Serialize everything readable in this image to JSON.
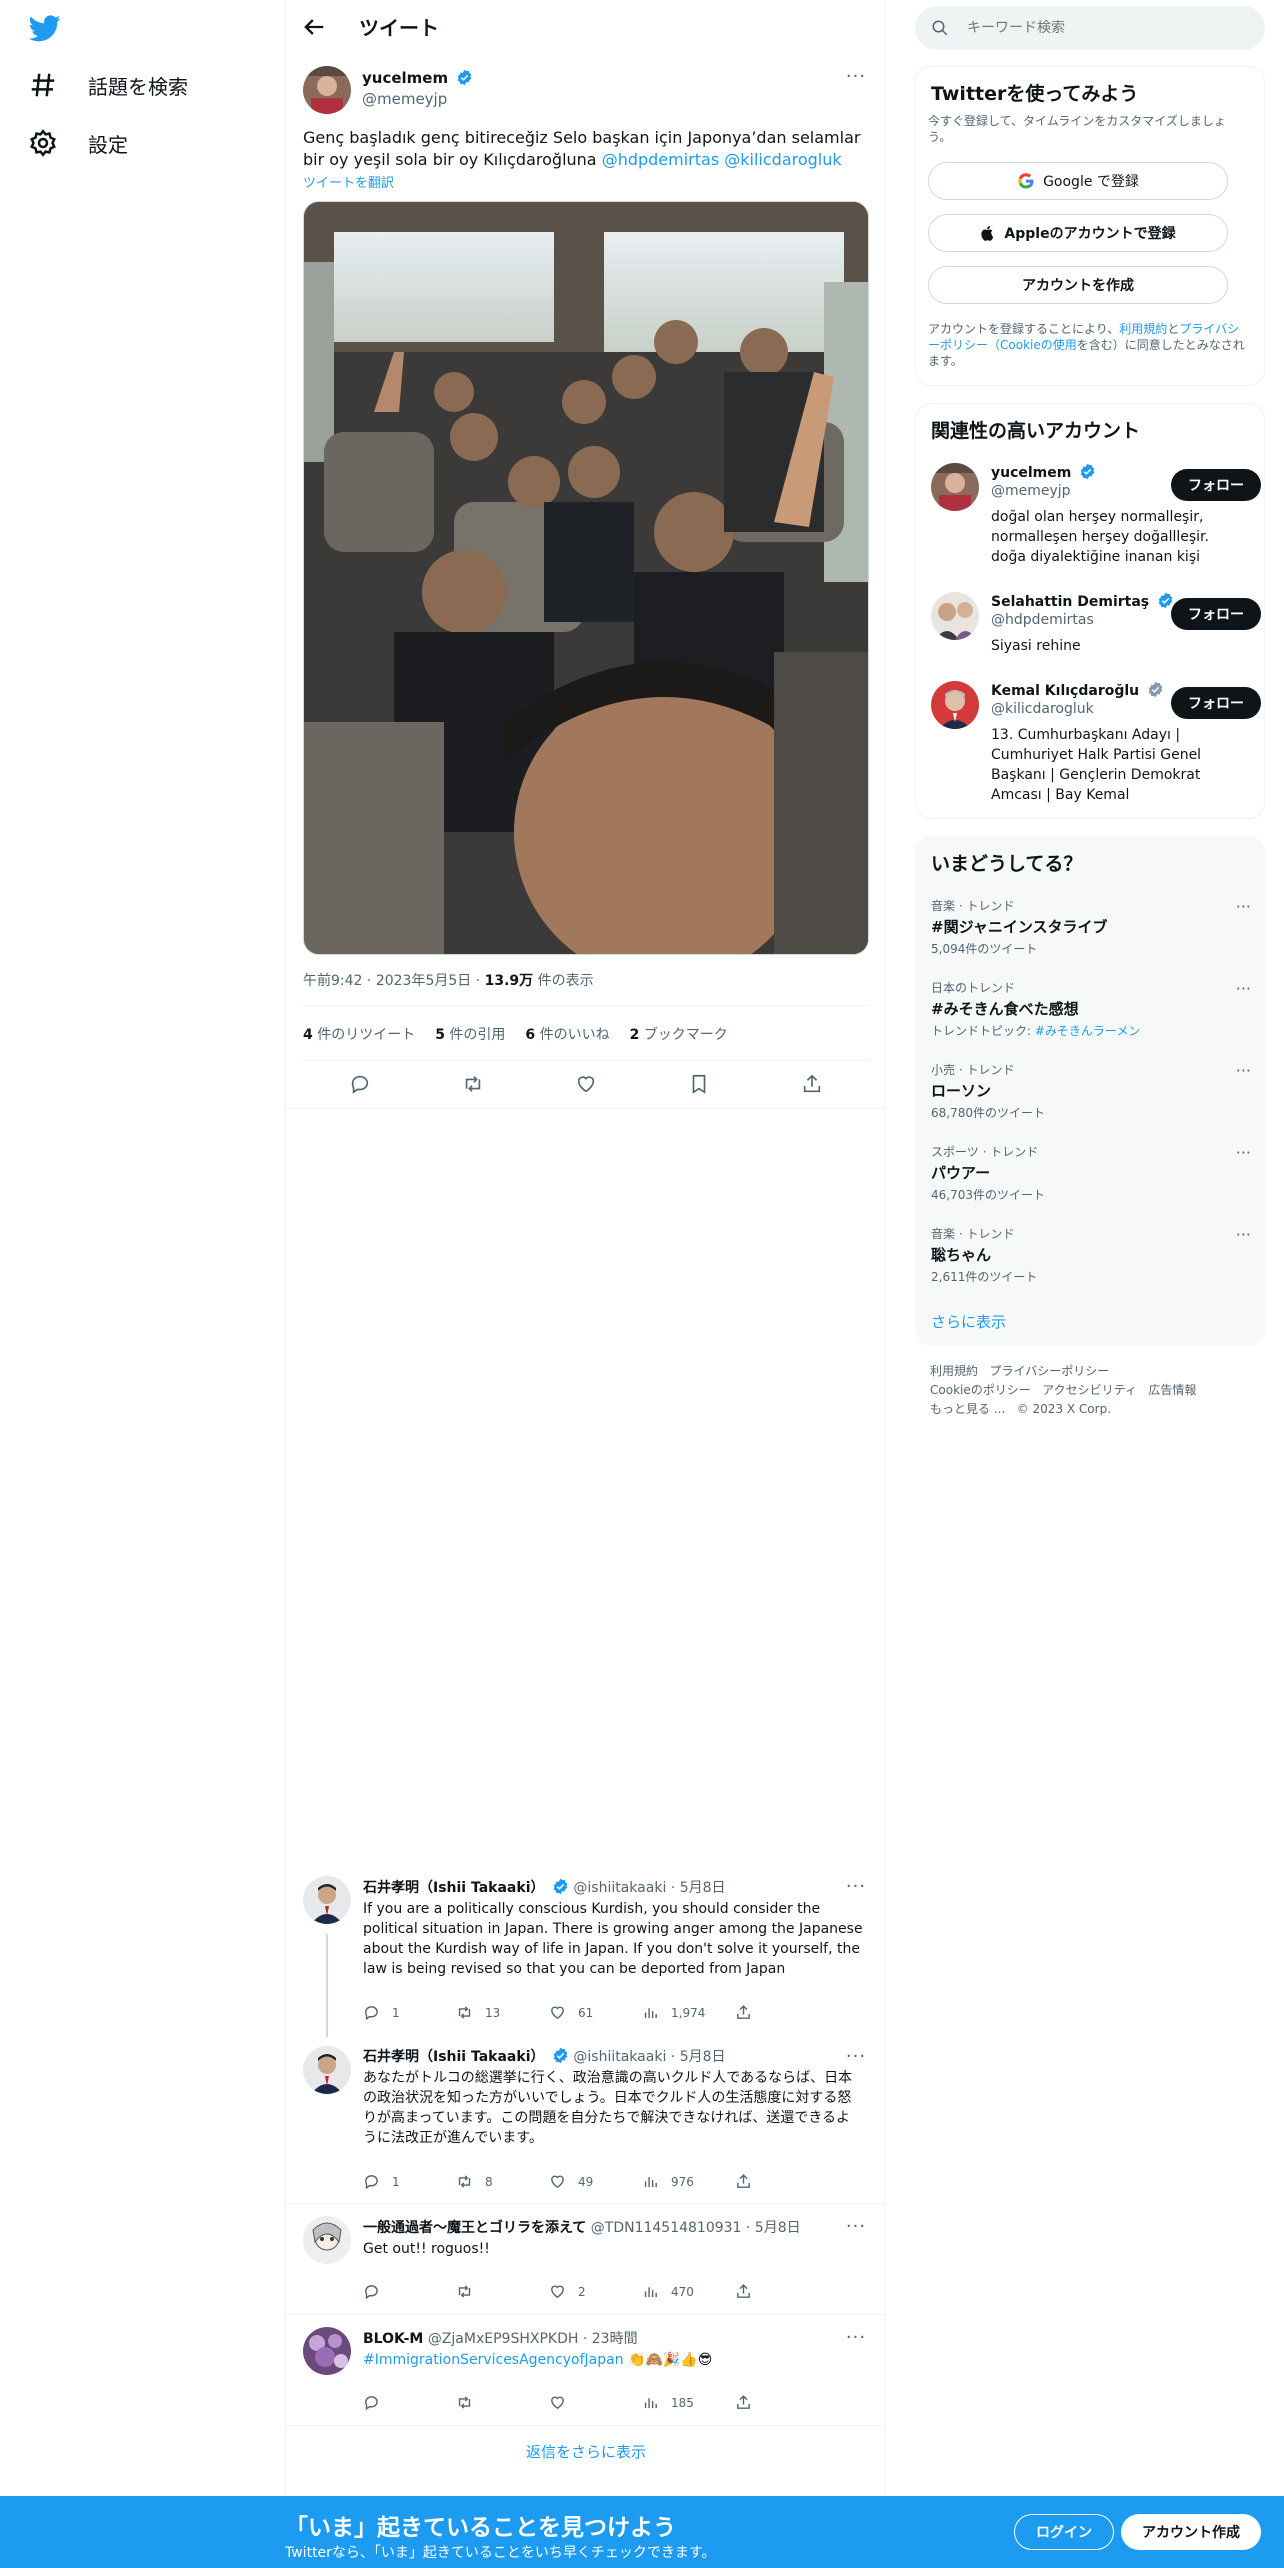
{
  "nav": {
    "explore_label": "話題を検索",
    "settings_label": "設定"
  },
  "header": {
    "title": "ツイート"
  },
  "tweet": {
    "display_name": "yucelmem",
    "handle": "@memeyjp",
    "text_plain": "Genç başladık genç bitireceğiz Selo başkan için Japonya’dan selamlar bir oy yeşil sola bir oy Kılıçdaroğluna ",
    "mention1": "@hdpdemirtas",
    "mention2": "@kilicdarogluk",
    "translate": "ツイートを翻訳",
    "time": "午前9:42",
    "date": "2023年5月5日",
    "views_num": "13.9万",
    "views_label": "件の表示",
    "stats": [
      {
        "num": "4",
        "label": "件のリツイート"
      },
      {
        "num": "5",
        "label": "件の引用"
      },
      {
        "num": "6",
        "label": "件のいいね"
      },
      {
        "num": "2",
        "label": "ブックマーク"
      }
    ]
  },
  "replies": [
    {
      "name": "石井孝明（Ishii Takaaki）",
      "handle": "@ishiitakaaki",
      "date": "5月8日",
      "text": "If you are a politically conscious Kurdish, you should consider the political situation in Japan. There is growing anger among the Japanese about the Kurdish way of life in Japan. If you don't solve it yourself, the law is being revised so that you can be deported from Japan",
      "reply_count": "1",
      "retweet_count": "13",
      "like_count": "61",
      "view_count": "1,974"
    },
    {
      "name": "石井孝明（Ishii Takaaki）",
      "handle": "@ishiitakaaki",
      "date": "5月8日",
      "text": "あなたがトルコの総選挙に行く、政治意識の高いクルド人であるならば、日本の政治状況を知った方がいいでしょう。日本でクルド人の生活態度に対する怒りが高まっています。この問題を自分たちで解決できなければ、送還できるように法改正が進んでいます。",
      "reply_count": "1",
      "retweet_count": "8",
      "like_count": "49",
      "view_count": "976"
    },
    {
      "name": "一般通過者～魔王とゴリラを添えて",
      "handle": "@TDN114514810931",
      "date": "5月8日",
      "text": "Get out!! roguos!!",
      "reply_count": "",
      "retweet_count": "",
      "like_count": "2",
      "view_count": "470"
    },
    {
      "name": "BLOK-M",
      "handle": "@ZjaMxEP9SHXPKDH",
      "date": "23時間",
      "hashtag": "#ImmigrationServicesAgencyofJapan",
      "emoji": "👏🙈🎉👍😎",
      "reply_count": "",
      "retweet_count": "",
      "like_count": "",
      "view_count": "185"
    }
  ],
  "show_more_replies": "返信をさらに表示",
  "search": {
    "placeholder": "キーワード検索"
  },
  "signup_card": {
    "title": "Twitterを使ってみよう",
    "subtitle": "今すぐ登録して、タイムラインをカスタマイズしましょう。",
    "google": "Google で登録",
    "apple": "Appleのアカウントで登録",
    "create": "アカウントを作成",
    "terms_pre": "アカウントを登録することにより、",
    "terms_link1": "利用規約",
    "terms_and": "と",
    "terms_link2": "プライバシーポリシー（Cookieの使用",
    "terms_post": "を含む）に同意したとみなされます。"
  },
  "accounts_card": {
    "title": "関連性の高いアカウント",
    "follow_label": "フォロー",
    "accounts": [
      {
        "name": "yucelmem",
        "handle": "@memeyjp",
        "bio": "doğal olan herşey normalleşir, normalleşen herşey doğallleşir. doğa diyalektiğine inanan kişi",
        "verified_color": "#1d9bf0"
      },
      {
        "name": "Selahattin Demirtaş",
        "handle": "@hdpdemirtas",
        "bio": "Siyasi rehine",
        "verified_color": "#1d9bf0"
      },
      {
        "name": "Kemal Kılıçdaroğlu",
        "handle": "@kilicdarogluk",
        "bio": "13. Cumhurbaşkanı Adayı | Cumhuriyet Halk Partisi Genel Başkanı | Gençlerin Demokrat Amcası | Bay Kemal",
        "verified_color": "#829aab"
      }
    ]
  },
  "trends_card": {
    "title": "いまどうしてる？",
    "trends": [
      {
        "category": "音楽 · トレンド",
        "title": "#関ジャニインスタライブ",
        "count": "5,094件のツイート"
      },
      {
        "category": "日本のトレンド",
        "title": "#みそきん食べた感想",
        "count_prefix": "トレンドトピック: ",
        "count_link": "#みそきんラーメン"
      },
      {
        "category": "小売 · トレンド",
        "title": "ローソン",
        "count": "68,780件のツイート"
      },
      {
        "category": "スポーツ · トレンド",
        "title": "パウアー",
        "count": "46,703件のツイート"
      },
      {
        "category": "音楽 · トレンド",
        "title": "聡ちゃん",
        "count": "2,611件のツイート"
      }
    ],
    "show_more": "さらに表示"
  },
  "footer": {
    "terms": "利用規約",
    "privacy": "プライバシーポリシー",
    "cookie": "Cookieのポリシー",
    "accessibility": "アクセシビリティ",
    "ads": "広告情報",
    "more": "もっと見る ...",
    "copyright": "© 2023 X Corp."
  },
  "bottom_bar": {
    "title": "「いま」起きていることを見つけよう",
    "subtitle": "Twitterなら、「いま」起きていることをいち早くチェックできます。",
    "login": "ログイン",
    "signup": "アカウント作成"
  },
  "colors": {
    "brand": "#1d9bf0",
    "text": "#0f1419",
    "muted": "#536471"
  }
}
